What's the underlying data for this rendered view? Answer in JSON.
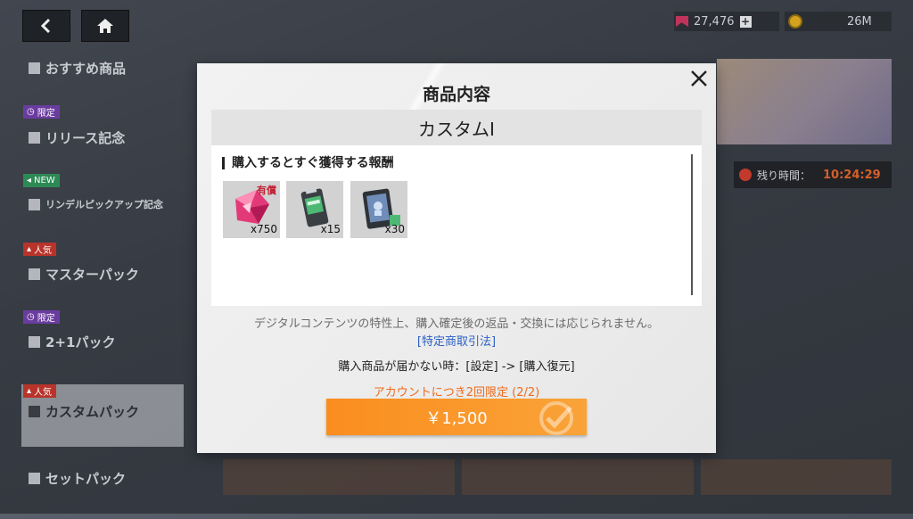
{
  "nav": {
    "back_icon": "chevron-left-icon",
    "home_icon": "home-icon"
  },
  "currency": {
    "gems": "27,476",
    "gold": "26M",
    "plus_label": "+"
  },
  "sidebar": {
    "items": [
      {
        "tag": "",
        "label": "おすすめ商品"
      },
      {
        "tag": "限定",
        "label": "リリース記念"
      },
      {
        "tag": "NEW",
        "label": "リンデルピックアップ記念"
      },
      {
        "tag": "人気",
        "label": "マスターパック"
      },
      {
        "tag": "限定",
        "label": "2+1パック"
      },
      {
        "tag": "人気",
        "label": "カスタムパック"
      },
      {
        "tag": "",
        "label": "セットパック"
      }
    ],
    "active_index": 5
  },
  "timer": {
    "label": "残り時間：",
    "value": "10:24:29"
  },
  "modal": {
    "title": "商品内容",
    "product_name": "カスタムI",
    "reward_title": "購入するとすぐ獲得する報酬",
    "items": [
      {
        "icon": "gem-icon",
        "badge": "有償",
        "qty": "x750"
      },
      {
        "icon": "battery-pack-icon",
        "badge": "",
        "qty": "x15"
      },
      {
        "icon": "device-card-icon",
        "badge": "",
        "qty": "x30"
      }
    ],
    "notice": "デジタルコンテンツの特性上、購入確定後の返品・交換には応じられません。",
    "law_link": "[特定商取引法]",
    "restore_note": "購入商品が届かない時：[設定] -> [購入復元]",
    "limit_note": "アカウントにつき2回限定 (2/2)",
    "price": "￥1,500"
  },
  "colors": {
    "button": "#fb8d1f",
    "limit_text": "#ef6a1a",
    "link": "#2b5fc4",
    "paid_badge": "#c21f33"
  }
}
